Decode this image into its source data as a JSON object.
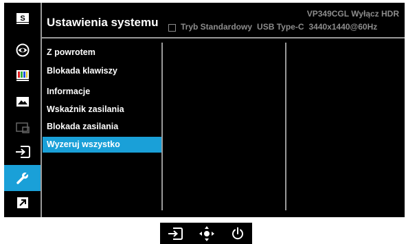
{
  "header": {
    "title": "Ustawienia systemu",
    "model": "VP349CGL Wyłącz HDR",
    "status": {
      "mode": "Tryb Standardowy",
      "input": "USB Type-C",
      "resolution": "3440x1440@60Hz"
    }
  },
  "sidebar": {
    "items": [
      {
        "icon": "splendid-s-icon",
        "active": false
      },
      {
        "icon": "eye-care-icon",
        "active": false
      },
      {
        "icon": "color-bars-icon",
        "active": false
      },
      {
        "icon": "image-landscape-icon",
        "active": false
      },
      {
        "icon": "pip-window-icon",
        "active": false
      },
      {
        "icon": "input-select-icon",
        "active": false
      },
      {
        "icon": "wrench-icon",
        "active": true
      },
      {
        "icon": "shortcut-arrow-icon",
        "active": false
      }
    ]
  },
  "menu": {
    "items": [
      {
        "label": "Z powrotem"
      },
      {
        "label": "Blokada klawiszy"
      },
      {
        "label": "Informacje"
      },
      {
        "label": "Wskaźnik zasilania"
      },
      {
        "label": "Blokada zasilania"
      },
      {
        "label": "Wyzeruj wszystko",
        "selected": true
      }
    ]
  },
  "keys": [
    {
      "icon": "input-key-icon"
    },
    {
      "icon": "five-way-navigation-icon"
    },
    {
      "icon": "power-icon"
    }
  ],
  "colors": {
    "accent": "#1aa0d8",
    "background": "#000000",
    "text": "#ffffff",
    "muted_text": "#8c8c8c",
    "divider": "#9a9a9a"
  }
}
